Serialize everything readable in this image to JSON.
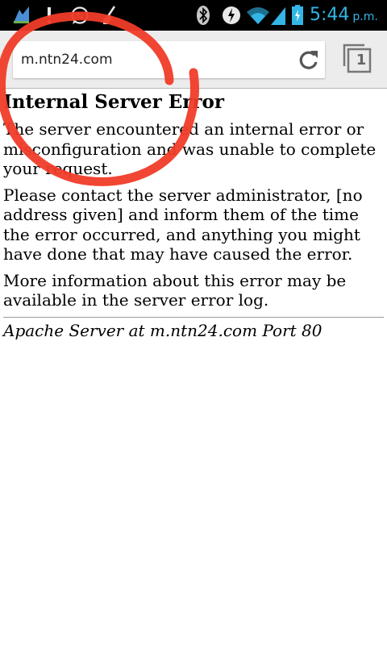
{
  "status_bar": {
    "time": "5:44",
    "ampm": "p.m.",
    "icons": [
      "notification-app-icon",
      "warning-icon",
      "whatsapp-icon",
      "cleaner-icon",
      "bluetooth-icon",
      "data-saver-icon",
      "wifi-icon",
      "signal-icon",
      "battery-charging-icon"
    ],
    "time_color": "#33b5e5"
  },
  "browser": {
    "url": "m.ntn24.com",
    "tab_count": "1"
  },
  "page": {
    "title": "Internal Server Error",
    "paragraph_1": "The server encountered an internal error or misconfiguration and was unable to complete your request.",
    "paragraph_2": "Please contact the server administrator, [no address given] and inform them of the time the error occurred, and anything you might have done that may have caused the error.",
    "paragraph_3": "More information about this error may be available in the server error log.",
    "signature": "Apache Server at m.ntn24.com Port 80"
  },
  "annotation": {
    "color": "#f03c28",
    "shape": "red-circle-scribble"
  }
}
